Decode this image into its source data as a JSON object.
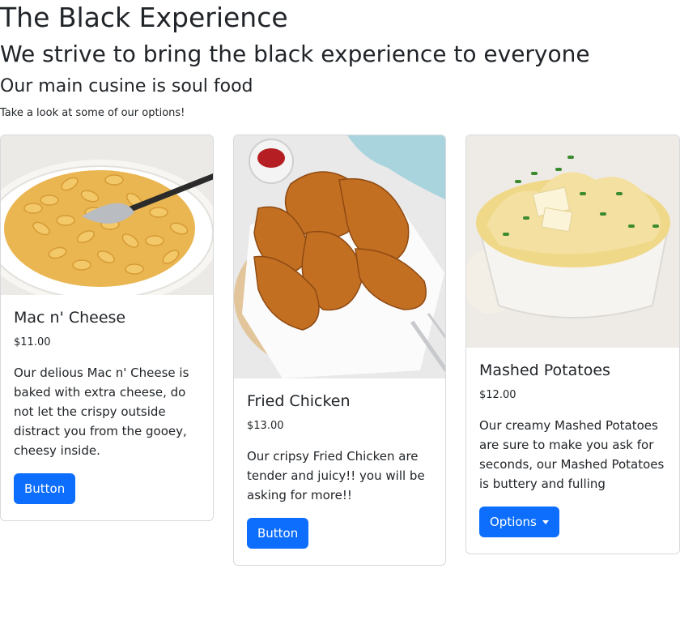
{
  "header": {
    "title": "The Black Experience",
    "subtitle": "We strive to bring the black experience to everyone",
    "cuisine": "Our main cusine is soul food",
    "intro": "Take a look at some of our options!"
  },
  "cards": [
    {
      "title": "Mac n' Cheese",
      "price": "$11.00",
      "description": "Our delious Mac n' Cheese is baked with extra cheese, do not let the crispy outside distract you from the gooey, cheesy inside.",
      "button": "Button"
    },
    {
      "title": "Fried Chicken",
      "price": "$13.00",
      "description": "Our cripsy Fried Chicken are tender and juicy!! you will be asking for more!!",
      "button": "Button"
    },
    {
      "title": "Mashed Potatoes",
      "price": "$12.00",
      "description": "Our creamy Mashed Potatoes are sure to make you ask for seconds, our Mashed Potatoes is buttery and fulling",
      "button": "Options"
    }
  ],
  "colors": {
    "primary": "#0d6efd",
    "text": "#212529",
    "border": "#d7d9dc"
  }
}
